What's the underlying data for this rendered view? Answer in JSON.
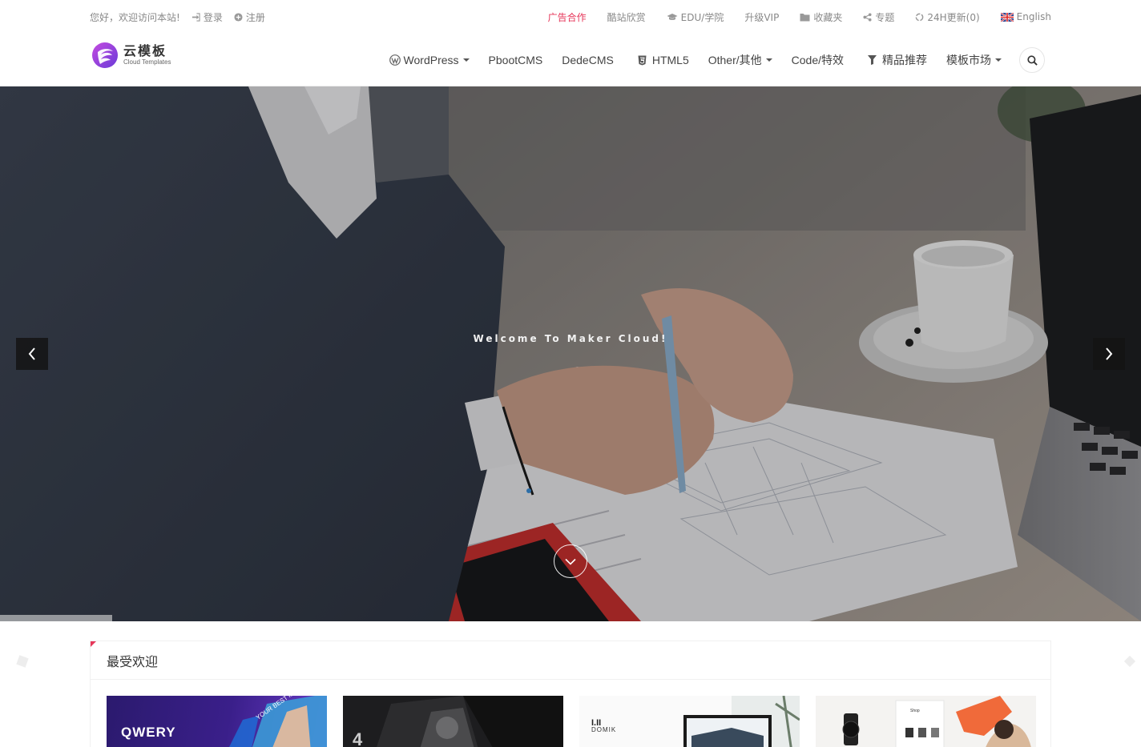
{
  "topbar": {
    "greeting": "您好，欢迎访问本站!",
    "login": "登录",
    "register": "注册",
    "links": {
      "ad": "广告合作",
      "cool_sites": "酷站欣赏",
      "edu": "EDU/学院",
      "vip": "升级VIP",
      "favorites": "收藏夹",
      "topics": "专题",
      "updates": "24H更新(0)",
      "language": "English"
    },
    "accent_color": "#e6375a"
  },
  "logo": {
    "title": "云模板",
    "subtitle": "Cloud Templates"
  },
  "nav": {
    "wordpress": "WordPress",
    "pbootcms": "PbootCMS",
    "dedecms": "DedeCMS",
    "html5": "HTML5",
    "other": "Other/其他",
    "code": "Code/特效",
    "featured": "精品推荐",
    "market": "模板市场",
    "icons": {
      "wordpress": "wordpress-icon",
      "html5": "html5-icon",
      "featured": "filter-icon",
      "search": "search-icon"
    }
  },
  "hero": {
    "title": "Welcome To Maker Cloud!"
  },
  "section": {
    "title": "最受欢迎",
    "cards": [
      {
        "label": "QWERY"
      },
      {
        "label": ""
      },
      {
        "label": "DOMIK"
      },
      {
        "label": ""
      }
    ]
  }
}
